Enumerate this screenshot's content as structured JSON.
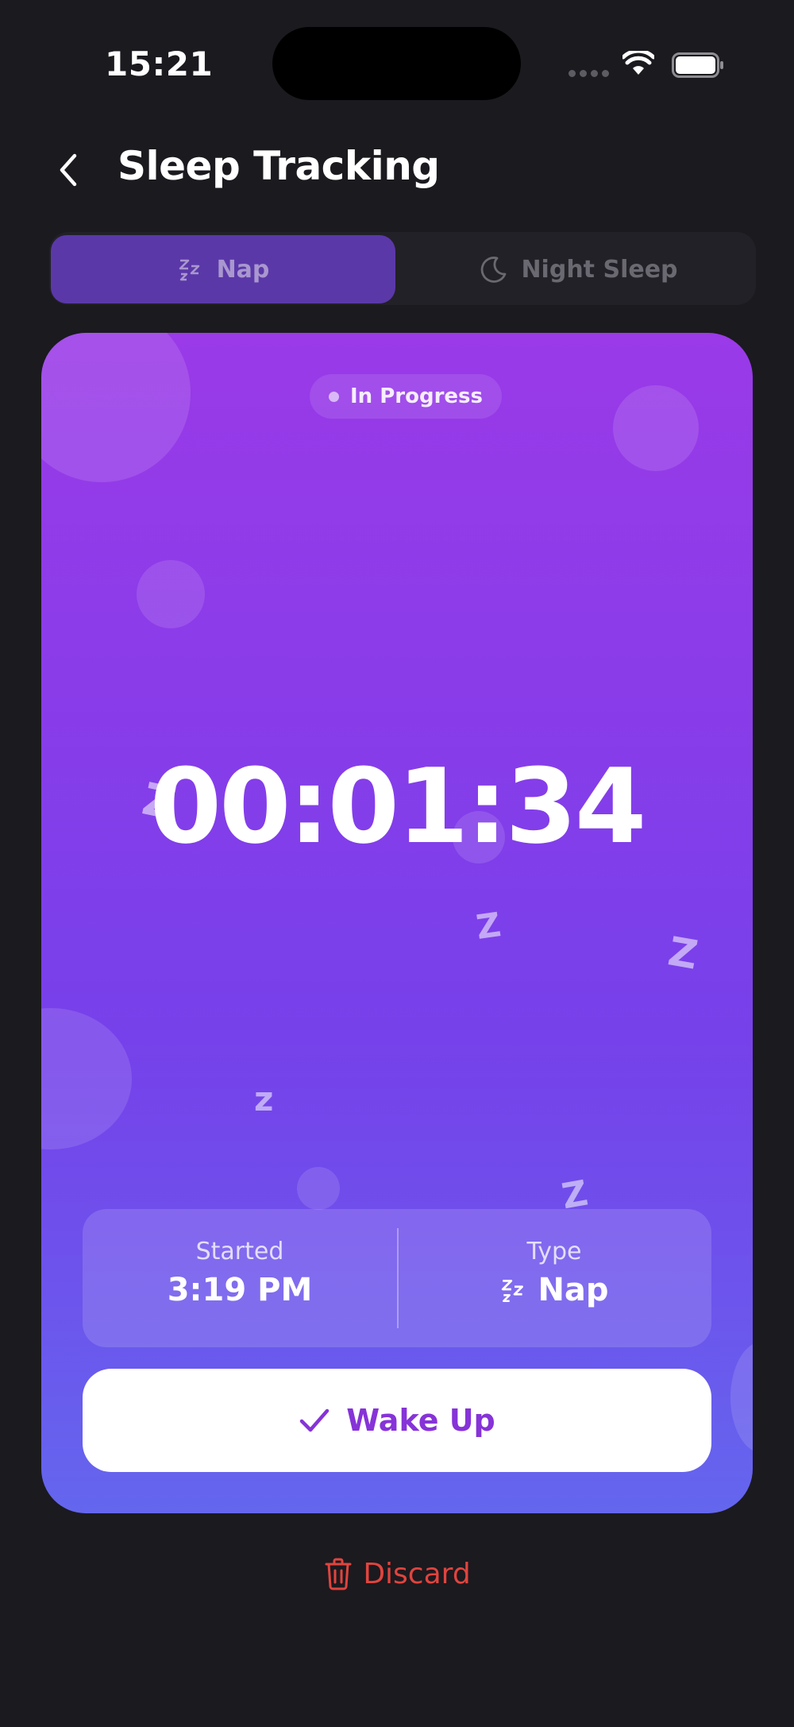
{
  "status_bar": {
    "time": "15:21"
  },
  "header": {
    "title": "Sleep Tracking"
  },
  "segment": {
    "tabs": [
      {
        "label": "Nap",
        "icon": "zzz-icon",
        "active": true
      },
      {
        "label": "Night Sleep",
        "icon": "moon-icon",
        "active": false
      }
    ]
  },
  "session": {
    "status": "In Progress",
    "elapsed": "00:01:34",
    "started_label": "Started",
    "started_value": "3:19 PM",
    "type_label": "Type",
    "type_value": "Nap",
    "wake_label": "Wake Up"
  },
  "discard_label": "Discard",
  "decor": {
    "z_glyph": "Z",
    "z_small": "z"
  },
  "colors": {
    "background": "#1b1a1f",
    "accent_purple": "#8633d8",
    "card_gradient_top": "#9a3ae8",
    "card_gradient_bottom": "#6466ee",
    "discard_red": "#e0443e"
  }
}
